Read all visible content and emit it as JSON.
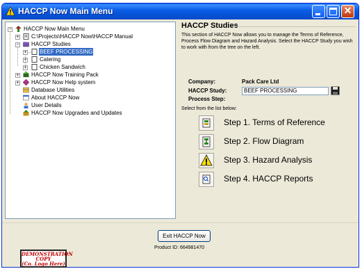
{
  "window": {
    "title": "HACCP Now Main Menu"
  },
  "tree": {
    "root": "HACCP Now Main Menu",
    "project_path": "C:\\Projects\\HACCP Now\\HACCP Manual",
    "studies_folder": "HACCP Studies",
    "studies": [
      "BEEF PROCESSING",
      "Catering",
      "Chicken Sandwich"
    ],
    "training_pack": "HACCP Now Training Pack",
    "help_system": "HACCP Now Help system",
    "db_utilities": "Database Utilities",
    "about": "About HACCP Now",
    "user_details": "User Details",
    "upgrades": "HACCP Now Upgrades and Updates"
  },
  "panel": {
    "title": "HACCP Studies",
    "description": "This section of HACCP Now allows you to manage the Terms of Reference, Process Flow Diagram and Hazard Analysis. Select the HACCP Study you wish to work with from the tree on the left.",
    "company_label": "Company:",
    "company_value": "Pack Care Ltd",
    "study_label": "HACCP Study:",
    "study_value": "BEEF PROCESSING",
    "process_step_label": "Process Step:",
    "select_prompt": "Select from the list below:",
    "steps": [
      "Step 1. Terms of Reference",
      "Step 2. Flow Diagram",
      "Step 3. Hazard Analysis",
      "Step 4. HACCP Reports"
    ]
  },
  "footer": {
    "exit_label": "Exit HACCP Now",
    "product_id": "Product ID: 664981470",
    "demo_line1": "DEMONSTRATION",
    "demo_line2": "COPY",
    "demo_line3": "(Co. Logo Here)"
  },
  "colors": {
    "titlebar": "#0A5FEA",
    "selection": "#316AC5",
    "window_bg": "#ECE9D8",
    "demo_text": "#C00000"
  }
}
